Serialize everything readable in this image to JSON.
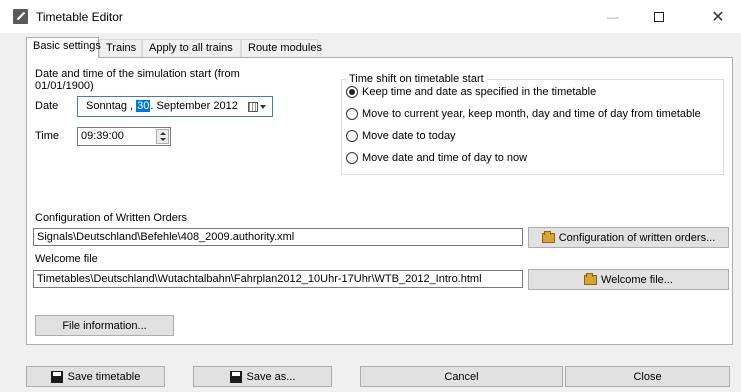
{
  "window": {
    "title": "Timetable Editor",
    "minimize_glyph": "—",
    "close_glyph": "✕",
    "icon": "timetable-editor-icon"
  },
  "tabs": [
    {
      "label": "Basic settings",
      "active": true
    },
    {
      "label": "Trains",
      "active": false
    },
    {
      "label": "Apply to all trains",
      "active": false
    },
    {
      "label": "Route modules",
      "active": false
    }
  ],
  "simulation_start": {
    "heading_line1": "Date and time of the simulation start (from",
    "heading_line2": "01/01/1900)",
    "date_label": "Date",
    "date_weekday": "Sonntag",
    "date_sep1": " , ",
    "date_day": "30",
    "date_rest": ". September 2012",
    "time_label": "Time",
    "time_value": "09:39:00"
  },
  "time_shift": {
    "title": "Time shift on timetable start",
    "options": [
      {
        "label": "Keep time and date as specified in the timetable",
        "selected": true
      },
      {
        "label": "Move to current year, keep month, day and time of day from timetable",
        "selected": false
      },
      {
        "label": "Move date to today",
        "selected": false
      },
      {
        "label": "Move date and time of day to now",
        "selected": false
      }
    ]
  },
  "written_orders": {
    "label": "Configuration of Written Orders",
    "value": "Signals\\Deutschland\\Befehle\\408_2009.authority.xml",
    "button": "Configuration of written orders..."
  },
  "welcome_file": {
    "label": "Welcome file",
    "value": "Timetables\\Deutschland\\Wutachtalbahn\\Fahrplan2012_10Uhr-17Uhr\\WTB_2012_Intro.html",
    "button": "Welcome file..."
  },
  "file_information_button": "File information...",
  "footer": {
    "save_timetable": "Save timetable",
    "save_as": "Save as...",
    "cancel": "Cancel",
    "close": "Close"
  },
  "colors": {
    "accent": "#0078d7",
    "button_face": "#e1e1e1",
    "folder": "#d6a536"
  }
}
